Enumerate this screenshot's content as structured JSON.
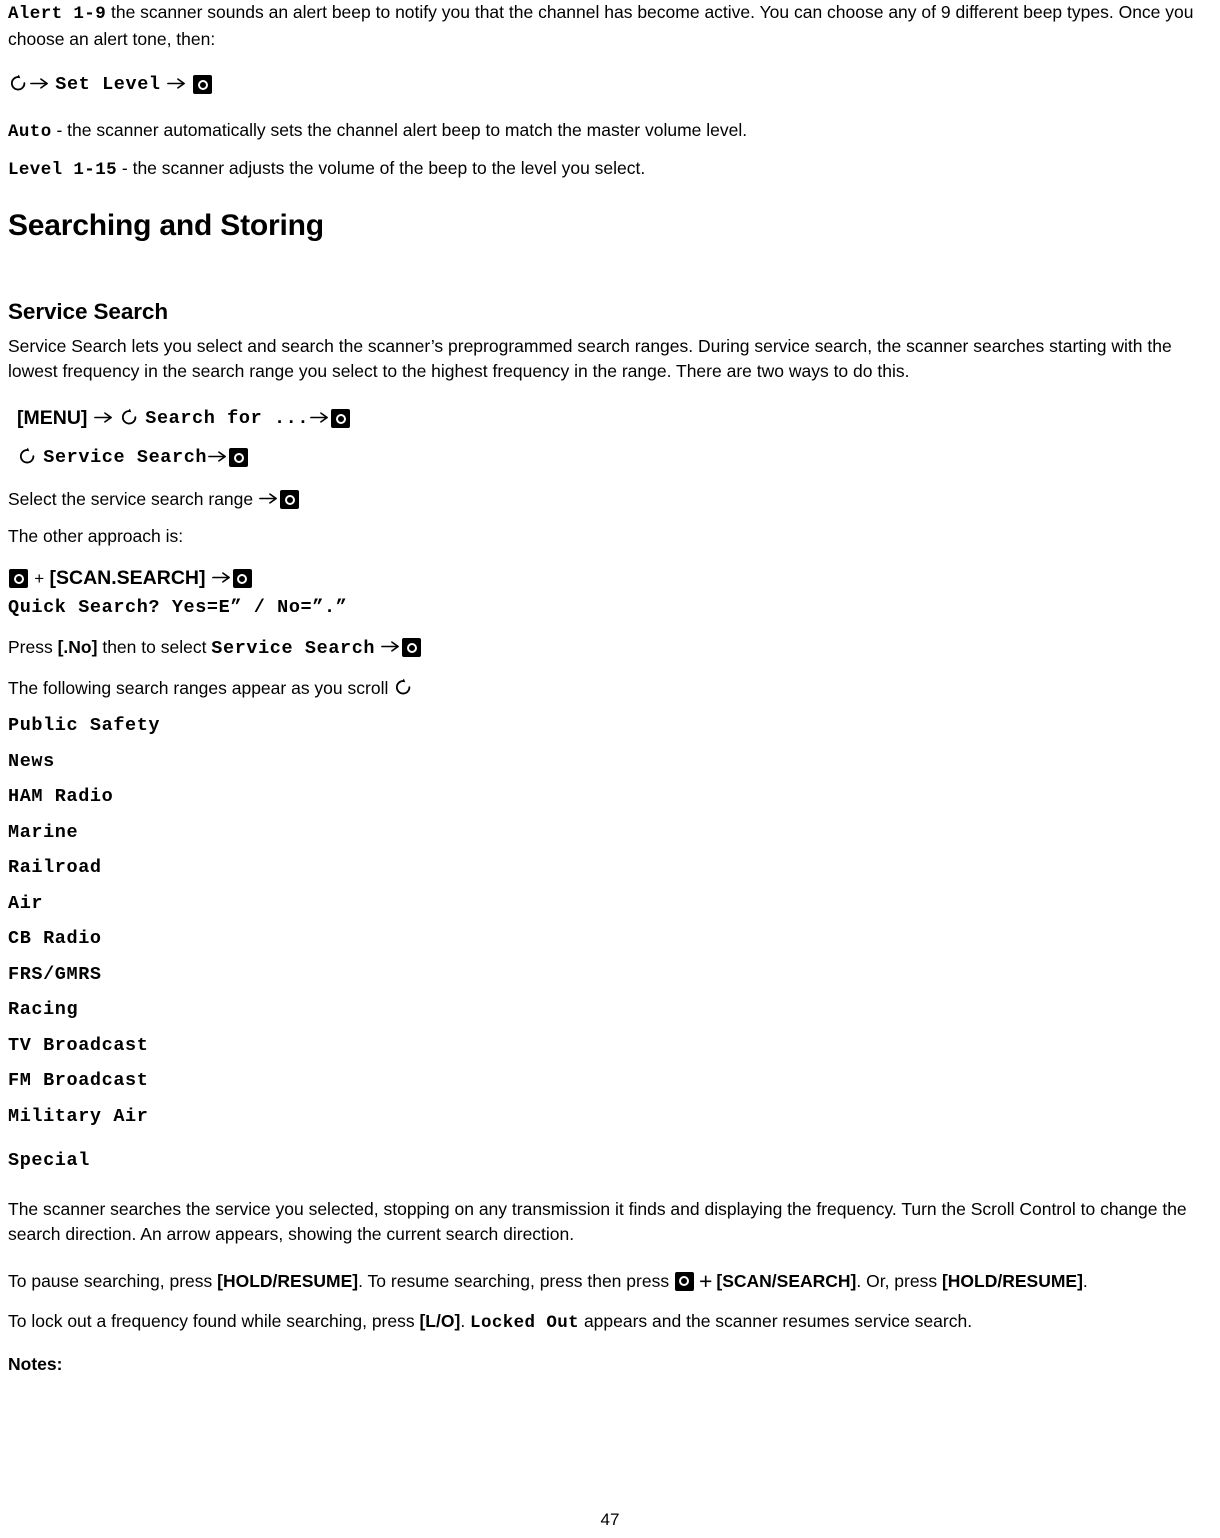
{
  "document": {
    "page_number": "47"
  },
  "alert_section": {
    "term": "Alert 1-9",
    "description_part1": " the scanner sounds an alert beep to notify you that the channel has become active. You can choose any of 9 different beep types. Once you choose an alert tone, then:",
    "step": {
      "scroll_icon": "scroll-control-icon",
      "arrow_icon": "right-arrow-icon",
      "label": "Set Level",
      "arrow2_icon": "right-arrow-icon",
      "button_icon": "select-button-icon"
    },
    "auto_term": "Auto",
    "auto_desc": " - the scanner automatically sets the channel alert beep to match the master volume level.",
    "level_term": "Level 1-15",
    "level_desc": " - the scanner adjusts the volume of the beep to the level you select."
  },
  "headings": {
    "chapter": "Searching and Storing",
    "section": "Service Search"
  },
  "service_search": {
    "intro": "Service Search lets you select and search the scanner’s preprogrammed search ranges. During service search, the scanner searches starting with the lowest frequency in the search range you select to the highest frequency in the range. There are two ways to do this.",
    "step1": {
      "menu_key": "[MENU]",
      "label": "Search for ...",
      "scroll_icon": "scroll-control-icon",
      "arrow_icon": "right-arrow-icon",
      "button_icon": "select-button-icon"
    },
    "step2": {
      "label": "Service Search",
      "scroll_icon": "scroll-control-icon",
      "arrow_icon": "right-arrow-icon",
      "button_icon": "select-button-icon"
    },
    "step3_text": "Select the service search range",
    "other_approach": "The other approach is:",
    "step4": {
      "plus": "+",
      "scan_search_key": "[SCAN.SEARCH]",
      "button_icon": "select-button-icon",
      "arrow_icon": "right-arrow-icon"
    },
    "quick_search_prompt": "Quick Search? Yes=E” / No=”.”",
    "press_no_prefix": "Press ",
    "press_no_key": "[.No]",
    "press_no_middle": " then to select ",
    "press_no_label": "Service Search",
    "scroll_intro": "The following search ranges appear as you scroll ",
    "ranges": [
      "Public Safety",
      "News",
      "HAM Radio",
      "Marine",
      "Railroad",
      "Air",
      "CB Radio",
      "FRS/GMRS",
      "Racing",
      "TV Broadcast",
      "FM Broadcast",
      "Military Air",
      "Special"
    ],
    "search_behavior": "The scanner searches the service you selected, stopping on any transmission it finds and displaying the frequency. Turn the Scroll Control to change the search direction. An arrow appears, showing the current search direction.",
    "pause": {
      "part1": "To pause searching, press ",
      "hold_key1": "[HOLD/RESUME]",
      "part2": ". To resume searching, press  then press ",
      "plus": "+",
      "scan_key": "[SCAN/SEARCH]",
      "part3": ". Or, press ",
      "hold_key2": "[HOLD/RESUME]",
      "part4": "."
    },
    "lockout": {
      "part1": "To lock out a frequency found while searching, press ",
      "lo_key": "[L/O]",
      "part2": ". ",
      "locked_out": "Locked Out",
      "part3": " appears and the scanner resumes service search."
    },
    "notes_label": "Notes:"
  }
}
